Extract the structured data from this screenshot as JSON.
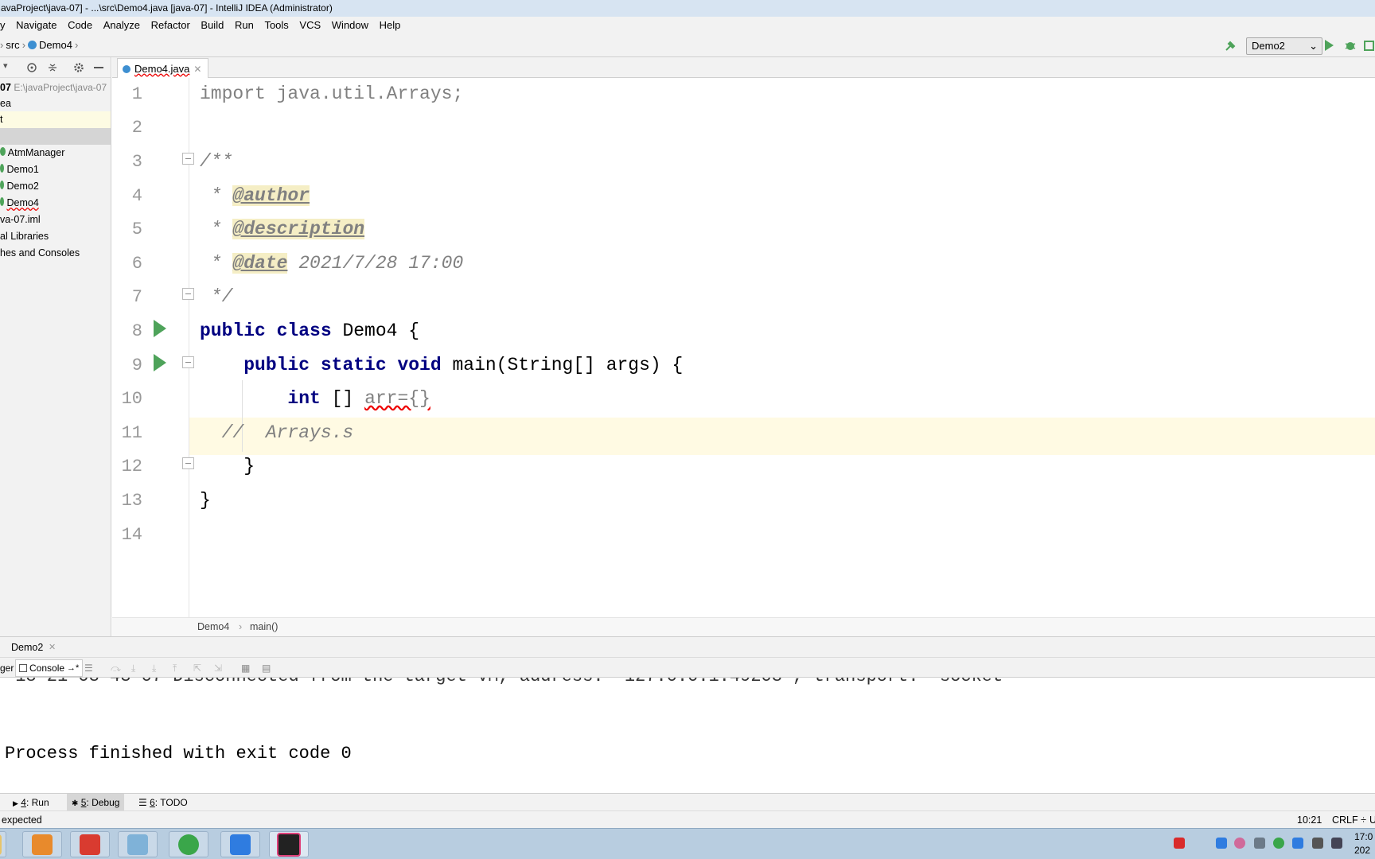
{
  "window": {
    "title": "avaProject\\java-07] - ...\\src\\Demo4.java [java-07] - IntelliJ IDEA (Administrator)"
  },
  "menu": [
    "Navigate",
    "Code",
    "Analyze",
    "Refactor",
    "Build",
    "Run",
    "Tools",
    "VCS",
    "Window",
    "Help"
  ],
  "nav": {
    "crumb1": "src",
    "crumb2": "Demo4",
    "run_config": "Demo2"
  },
  "project_tree": [
    {
      "label": "07",
      "suffix": "E:\\javaProject\\java-07"
    },
    {
      "label": "ea",
      "suffix": ""
    },
    {
      "label": "t",
      "suffix": ""
    },
    {
      "label": "",
      "suffix": ""
    },
    {
      "label": "AtmManager",
      "suffix": ""
    },
    {
      "label": "Demo1",
      "suffix": ""
    },
    {
      "label": "Demo2",
      "suffix": ""
    },
    {
      "label": "Demo4",
      "suffix": ""
    },
    {
      "label": "va-07.iml",
      "suffix": ""
    },
    {
      "label": "al Libraries",
      "suffix": ""
    },
    {
      "label": "hes and Consoles",
      "suffix": ""
    }
  ],
  "editor": {
    "tab_label": "Demo4.java",
    "line_numbers": [
      "1",
      "2",
      "3",
      "4",
      "5",
      "6",
      "7",
      "8",
      "9",
      "10",
      "11",
      "12",
      "13",
      "14"
    ],
    "lines": {
      "l1_kw": "import",
      "l1_rest": " java.util.Arrays;",
      "l3": "/**",
      "l4_star": " * ",
      "l4_tag": "@author",
      "l5_star": " * ",
      "l5_tag": "@description",
      "l6_star": " * ",
      "l6_tag": "@date",
      "l6_rest": " 2021/7/28 17:00",
      "l7": " */",
      "l8_kw": "public class",
      "l8_rest": " Demo4 {",
      "l9_indent": "    ",
      "l9_kw": "public static void",
      "l9_rest": " main(String[] args) {",
      "l10_indent": "        ",
      "l10_kw": "int",
      "l10_rest1": " [] ",
      "l10_rest2": "arr={}",
      "l11": "  //  Arrays.s",
      "l12": "    }",
      "l13": "}"
    },
    "breadcrumb": {
      "class": "Demo4",
      "method": "main()"
    }
  },
  "debug": {
    "session_tab": "Demo2",
    "debugger_tab": "ger",
    "console_tab": "Console",
    "console_arrow": "→*"
  },
  "console": {
    "line_partial": "-18 21-03 43 07 Disconnected from the target VM, address: '127.0.0.1:49203', transport: 'socket'",
    "line_exit": "Process finished with exit code 0"
  },
  "tool_windows": [
    {
      "num": "4",
      "label": ": Run"
    },
    {
      "num": "5",
      "label": ": Debug"
    },
    {
      "num": "6",
      "label": ": TODO"
    }
  ],
  "status": {
    "message": "expected",
    "position": "10:21",
    "line_sep": "CRLF ÷",
    "encoding": "U"
  },
  "tray": {
    "clock_time": "17:0",
    "clock_date": "202"
  },
  "colors": {
    "keyword": "#000080",
    "comment": "#808080",
    "caret_line": "#fffae3",
    "run_green": "#4ea35a"
  }
}
